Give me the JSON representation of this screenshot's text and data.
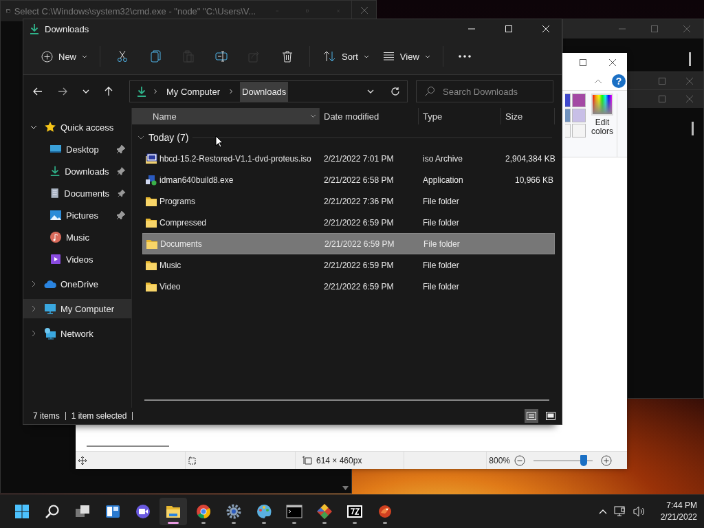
{
  "console_window": {
    "title": "Select C:\\Windows\\system32\\cmd.exe  - \"node\"   \"C:\\Users\\V..."
  },
  "paint_window": {
    "help_button": "?",
    "edit_colors": "Edit colors",
    "image_size": "614 × 460px",
    "zoom": {
      "reading": "800%",
      "level": 0.85
    },
    "swatches": [
      {
        "color": "#3f48cc"
      },
      {
        "color": "#a349a4"
      },
      {
        "color": "#7092be"
      },
      {
        "color": "#c8bfe7"
      },
      {
        "color": "#f4f4f4"
      },
      {
        "color": "#f4f4f4"
      }
    ]
  },
  "explorer": {
    "title": "Downloads",
    "toolbar": {
      "new_button": "New",
      "sort_button": "Sort",
      "view_button": "View",
      "actions": [
        {
          "kind": "cut",
          "disabled": false
        },
        {
          "kind": "copy",
          "disabled": false
        },
        {
          "kind": "paste",
          "disabled": true
        },
        {
          "kind": "rename",
          "disabled": false
        },
        {
          "kind": "share",
          "disabled": true
        },
        {
          "kind": "delete",
          "disabled": false
        }
      ]
    },
    "breadcrumbs": [
      {
        "label": "My Computer",
        "selected": false
      },
      {
        "label": "Downloads",
        "selected": true
      }
    ],
    "search": {
      "placeholder": "Search Downloads"
    },
    "sidebar": {
      "items": [
        {
          "label": "Quick access",
          "kind": "star",
          "expanded": true,
          "selected": false,
          "children": [
            {
              "label": "Desktop",
              "kind": "desktop",
              "pinned": true
            },
            {
              "label": "Downloads",
              "kind": "download",
              "pinned": true
            },
            {
              "label": "Documents",
              "kind": "document",
              "pinned": true
            },
            {
              "label": "Pictures",
              "kind": "picture",
              "pinned": true
            },
            {
              "label": "Music",
              "kind": "music",
              "pinned": false
            },
            {
              "label": "Videos",
              "kind": "video",
              "pinned": false
            }
          ]
        },
        {
          "label": "OneDrive",
          "kind": "cloud",
          "expanded": false,
          "selected": false
        },
        {
          "label": "My Computer",
          "kind": "computer",
          "expanded": false,
          "selected": true
        },
        {
          "label": "Network",
          "kind": "network",
          "expanded": false,
          "selected": false
        }
      ]
    },
    "columns": [
      "Name",
      "Date modified",
      "Type",
      "Size"
    ],
    "group": {
      "label": "Today (7)",
      "expanded": true
    },
    "rows": [
      {
        "name": "hbcd-15.2-Restored-V1.1-dvd-proteus.iso",
        "date": "2/21/2022 7:01 PM",
        "type": "iso Archive",
        "size": "2,904,384 KB",
        "kind": "iso",
        "selected": false
      },
      {
        "name": "idman640build8.exe",
        "date": "2/21/2022 6:58 PM",
        "type": "Application",
        "size": "10,966 KB",
        "kind": "exe",
        "selected": false
      },
      {
        "name": "Programs",
        "date": "2/21/2022 7:36 PM",
        "type": "File folder",
        "kind": "folder",
        "selected": false
      },
      {
        "name": "Compressed",
        "date": "2/21/2022 6:59 PM",
        "type": "File folder",
        "kind": "folder",
        "selected": false
      },
      {
        "name": "Documents",
        "date": "2/21/2022 6:59 PM",
        "type": "File folder",
        "kind": "folder",
        "selected": true
      },
      {
        "name": "Music",
        "date": "2/21/2022 6:59 PM",
        "type": "File folder",
        "kind": "folder",
        "selected": false
      },
      {
        "name": "Video",
        "date": "2/21/2022 6:59 PM",
        "type": "File folder",
        "kind": "folder",
        "selected": false
      }
    ],
    "status_bar": {
      "item_count": "7 items",
      "selection": "1 item selected",
      "views": [
        {
          "kind": "details",
          "selected": true
        },
        {
          "kind": "tiles",
          "selected": false
        }
      ]
    }
  },
  "taskbar": {
    "apps": [
      {
        "kind": "start",
        "running": false,
        "active": false
      },
      {
        "kind": "search",
        "running": false,
        "active": false
      },
      {
        "kind": "taskview",
        "running": false,
        "active": false
      },
      {
        "kind": "widgets",
        "running": false,
        "active": false
      },
      {
        "kind": "chat",
        "running": false,
        "active": false
      },
      {
        "kind": "explorer",
        "running": true,
        "active": true
      },
      {
        "kind": "chrome",
        "running": true,
        "active": false
      },
      {
        "kind": "settings",
        "running": true,
        "active": false
      },
      {
        "kind": "paint",
        "running": true,
        "active": false
      },
      {
        "kind": "terminal",
        "running": true,
        "active": false
      },
      {
        "kind": "git",
        "running": true,
        "active": false
      },
      {
        "kind": "sevenzip",
        "running": true,
        "active": false
      },
      {
        "kind": "bird",
        "running": true,
        "active": false
      }
    ],
    "time": "7:44 PM",
    "date": "2/21/2022"
  }
}
